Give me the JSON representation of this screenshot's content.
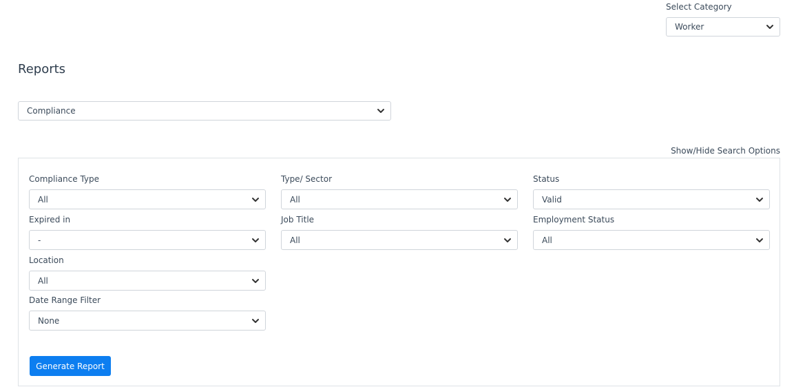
{
  "category": {
    "label": "Select Category",
    "selected": "Worker"
  },
  "page": {
    "title": "Reports"
  },
  "report_type": {
    "selected": "Compliance"
  },
  "search": {
    "toggle_label": "Show/Hide Search Options",
    "fields": {
      "compliance_type": {
        "label": "Compliance Type",
        "value": "All"
      },
      "type_sector": {
        "label": "Type/ Sector",
        "value": "All"
      },
      "status": {
        "label": "Status",
        "value": "Valid"
      },
      "expired_in": {
        "label": "Expired in",
        "value": "-"
      },
      "job_title": {
        "label": "Job Title",
        "value": "All"
      },
      "employment_status": {
        "label": "Employment Status",
        "value": "All"
      },
      "location": {
        "label": "Location",
        "value": "All"
      },
      "date_range_filter": {
        "label": "Date Range Filter",
        "value": "None"
      }
    },
    "generate_label": "Generate Report"
  },
  "colors": {
    "primary_button": "#0d7ef0",
    "border": "#cfd4da",
    "text": "#3b4a5a"
  }
}
